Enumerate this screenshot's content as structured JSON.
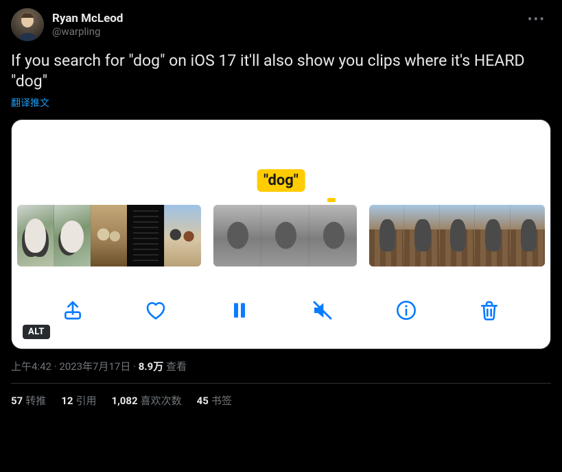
{
  "author": {
    "display_name": "Ryan McLeod",
    "handle": "@warpling"
  },
  "tweet_text": "If you search for \"dog\" on iOS 17 it'll also show you clips where it's HEARD \"dog\"",
  "translate_label": "翻译推文",
  "media": {
    "chip_text": "\"dog\"",
    "alt_badge": "ALT"
  },
  "meta": {
    "time": "上午4:42",
    "date": "2023年7月17日",
    "views_count": "8.9万",
    "views_label": "查看",
    "dot": " · "
  },
  "stats": {
    "retweets": {
      "count": "57",
      "label": "转推"
    },
    "quotes": {
      "count": "12",
      "label": "引用"
    },
    "likes": {
      "count": "1,082",
      "label": "喜欢次数"
    },
    "bookmarks": {
      "count": "45",
      "label": "书签"
    }
  }
}
